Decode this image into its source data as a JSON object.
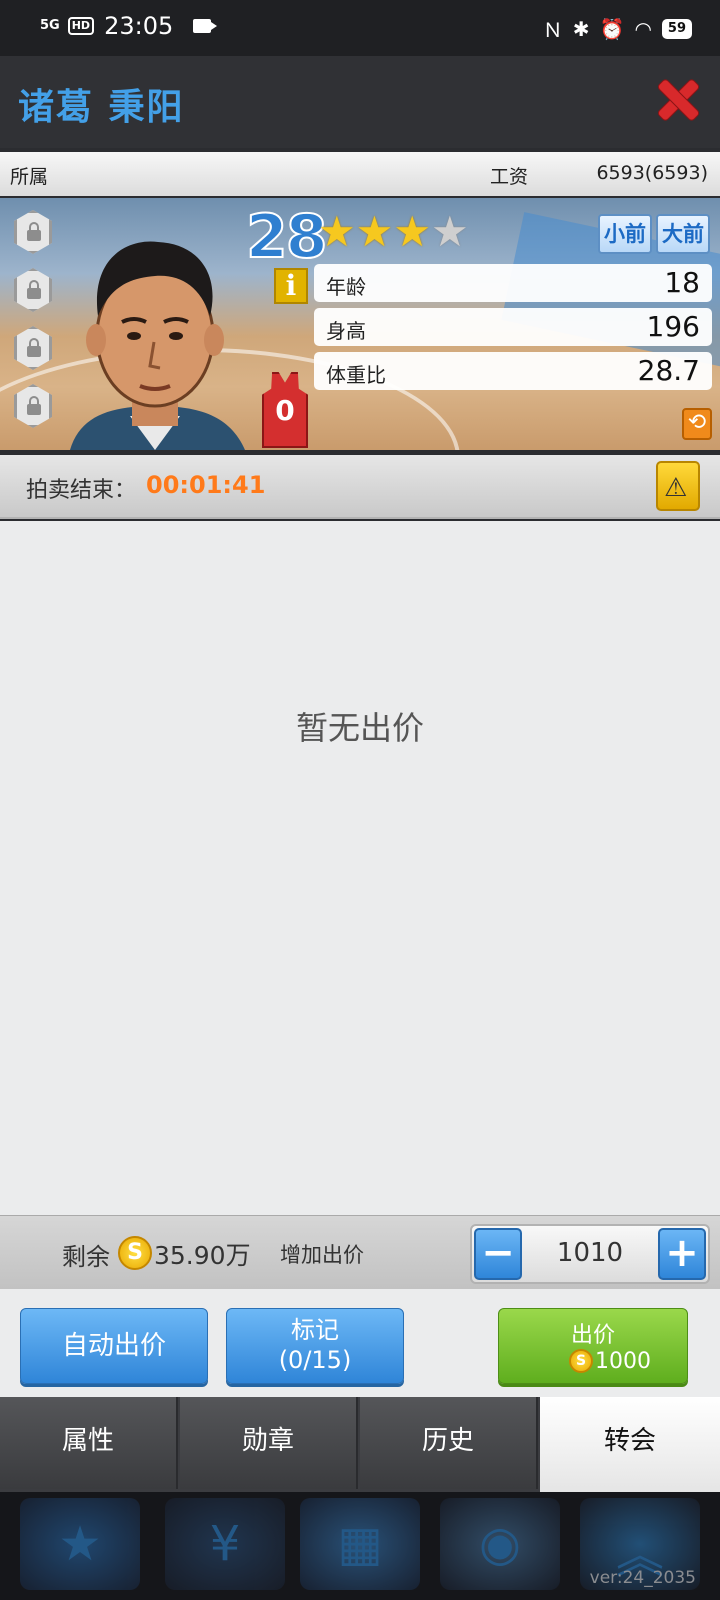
{
  "status_bar": {
    "network": "5G",
    "hd": "HD",
    "time": "23:05",
    "battery": "59"
  },
  "header": {
    "player_name": "诸葛 秉阳"
  },
  "info_row": {
    "affiliation_label": "所属",
    "salary_label": "工资",
    "salary_value": "6593(6593)"
  },
  "player_card": {
    "rating": "28",
    "stars_filled": 3,
    "stars_total": 4,
    "star_fill_level": 3.5,
    "position_buttons": [
      "小前",
      "大前"
    ],
    "info_icon_label": "i",
    "stats": [
      {
        "label": "年龄",
        "value": "18"
      },
      {
        "label": "身高",
        "value": "196"
      },
      {
        "label": "体重比",
        "value": "28.7"
      }
    ],
    "jersey_number": "0",
    "colors": {
      "rating": "#2f7fd0",
      "jersey": "#d42f2f"
    }
  },
  "auction": {
    "label": "拍卖结束：",
    "time_remaining": "00:01:41",
    "time_color": "#ff7a1a"
  },
  "bids": {
    "empty_text": "暂无出价"
  },
  "bid_controls": {
    "remaining_label": "剩余",
    "coin_symbol": "S",
    "remaining_value": "35.90万",
    "increase_label": "增加出价",
    "minus": "−",
    "plus": "+",
    "increment_value": "1010"
  },
  "actions": {
    "auto_bid": "自动出价",
    "mark_label": "标记",
    "mark_count": "(0/15)",
    "bid_label": "出价",
    "bid_amount": "1000"
  },
  "tabs": [
    {
      "label": "属性",
      "active": false
    },
    {
      "label": "勋章",
      "active": false
    },
    {
      "label": "历史",
      "active": false
    },
    {
      "label": "转会",
      "active": true
    }
  ],
  "footer": {
    "version": "ver:24_2035"
  }
}
